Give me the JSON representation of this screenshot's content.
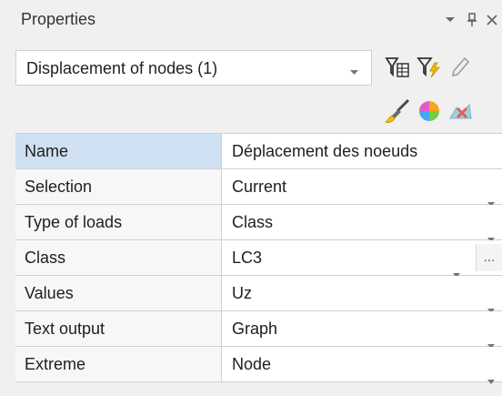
{
  "panel": {
    "title": "Properties",
    "window_buttons": {
      "menu_icon": "chevron-down-icon",
      "pin_icon": "pin-icon",
      "close_icon": "close-icon"
    }
  },
  "toolbar": {
    "dropdown_value": "Displacement of nodes (1)",
    "icons": [
      "filter-table-icon",
      "filter-lightning-icon",
      "pencil-icon",
      "brush-icon",
      "pie-chart-icon",
      "remove-icon"
    ]
  },
  "table": {
    "header": {
      "name": "Name",
      "value": "Déplacement des noeuds"
    },
    "rows": [
      {
        "name": "Selection",
        "value": "Current"
      },
      {
        "name": "Type of loads",
        "value": "Class"
      },
      {
        "name": "Class",
        "value": "LC3",
        "button": "..."
      },
      {
        "name": "Values",
        "value": "Uz"
      },
      {
        "name": "Text output",
        "value": "Graph"
      },
      {
        "name": "Extreme",
        "value": "Node"
      }
    ]
  },
  "colors": {
    "background": "#f0f0f0",
    "header_row": "#cfe0f2",
    "grid_line": "#d0d0d0"
  }
}
